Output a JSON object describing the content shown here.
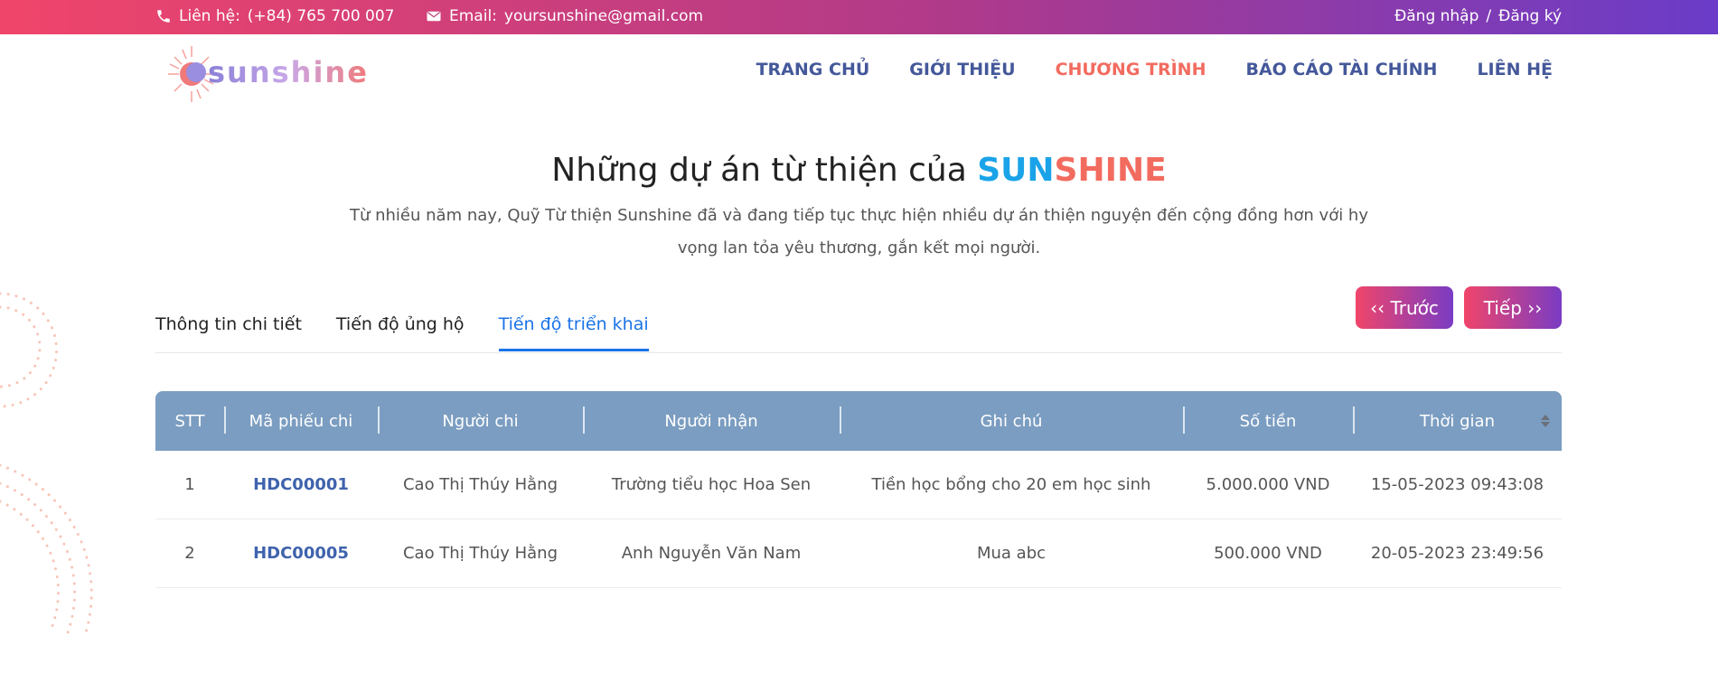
{
  "topbar": {
    "phone_label": "Liên hệ:",
    "phone": "(+84) 765 700 007",
    "email_label": "Email:",
    "email": "yoursunshine@gmail.com",
    "login": "Đăng nhập",
    "separator": "/",
    "register": "Đăng ký",
    "gradient": [
      "#f0456a",
      "#6a3cc8"
    ]
  },
  "brand": {
    "name": "sunshine"
  },
  "nav": {
    "home": "TRANG CHỦ",
    "about": "GIỚI THIỆU",
    "program": "CHƯƠNG TRÌNH",
    "finance": "BÁO CÁO TÀI CHÍNH",
    "contact": "LIÊN HỆ",
    "active_color": "#f26b5f"
  },
  "hero": {
    "title_prefix": "Những dự án từ thiện của",
    "title_brand_1": "SUN",
    "title_brand_2": "SHINE",
    "description": "Từ nhiều năm nay, Quỹ Từ thiện Sunshine đã và đang tiếp tục thực hiện nhiều dự án thiện nguyện đến cộng đồng hơn với hy vọng lan tỏa yêu thương, gắn kết mọi người."
  },
  "tabs": {
    "details": "Thông tin chi tiết",
    "donations": "Tiến độ ủng hộ",
    "deployment": "Tiến độ triển khai"
  },
  "pager": {
    "prev": "‹‹ Trước",
    "next": "Tiếp ››"
  },
  "table": {
    "header_color": "#7b9dc1",
    "columns": {
      "stt": "STT",
      "code": "Mã phiếu chi",
      "payer": "Người chi",
      "receiver": "Người nhận",
      "note": "Ghi chú",
      "amount": "Số tiền",
      "time": "Thời gian"
    },
    "rows": [
      {
        "stt": "1",
        "code": "HDC00001",
        "payer": "Cao Thị Thúy Hằng",
        "receiver": "Trường tiểu học Hoa Sen",
        "note": "Tiền học bổng cho 20 em học sinh",
        "amount": "5.000.000 VND",
        "time": "15-05-2023 09:43:08"
      },
      {
        "stt": "2",
        "code": "HDC00005",
        "payer": "Cao Thị Thúy Hằng",
        "receiver": "Anh Nguyễn Văn Nam",
        "note": "Mua abc",
        "amount": "500.000 VND",
        "time": "20-05-2023 23:49:56"
      }
    ]
  }
}
